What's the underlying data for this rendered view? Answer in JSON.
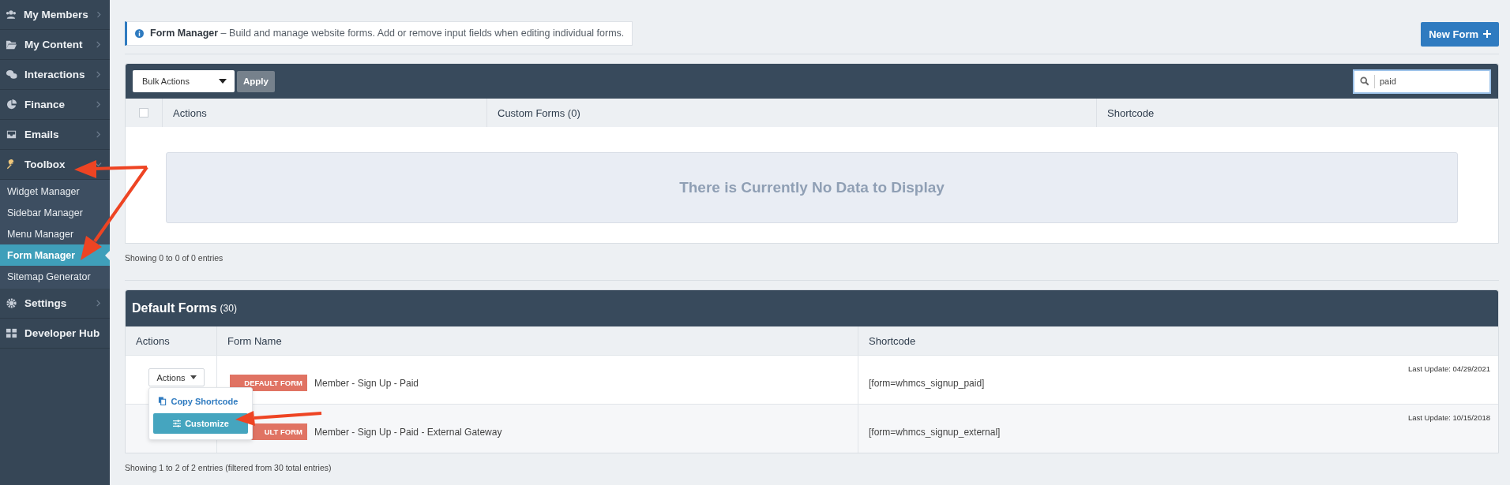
{
  "sidebar": {
    "items": [
      {
        "label": "My Members",
        "kind": "menu",
        "expanded": false
      },
      {
        "label": "My Content",
        "kind": "menu",
        "expanded": false
      },
      {
        "label": "Interactions",
        "kind": "menu",
        "expanded": false
      },
      {
        "label": "Finance",
        "kind": "menu",
        "expanded": false
      },
      {
        "label": "Emails",
        "kind": "menu",
        "expanded": false
      },
      {
        "label": "Toolbox",
        "kind": "menu",
        "expanded": true,
        "children": [
          {
            "label": "Widget Manager",
            "selected": false
          },
          {
            "label": "Sidebar Manager",
            "selected": false
          },
          {
            "label": "Menu Manager",
            "selected": false
          },
          {
            "label": "Form Manager",
            "selected": true
          },
          {
            "label": "Sitemap Generator",
            "selected": false
          }
        ]
      },
      {
        "label": "Settings",
        "kind": "menu",
        "expanded": false
      },
      {
        "label": "Developer Hub",
        "kind": "link",
        "expanded": false
      }
    ]
  },
  "notice": {
    "text": "**Form Manager** – Build and manage website forms. Add or remove input fields when editing individual forms."
  },
  "new_form_button": {
    "label": "New Form"
  },
  "custom_forms": {
    "bulk_actions": {
      "value": "Bulk Actions"
    },
    "apply_button": "Apply",
    "search": {
      "value": "paid"
    },
    "select_all": {
      "checked": false
    },
    "columns": [
      "Actions",
      "Custom Forms (0)",
      "Shortcode"
    ],
    "empty_message": "There is Currently No Data to Display",
    "footer": "Showing 0 to 0 of 0 entries"
  },
  "default_forms": {
    "title": "Default Forms",
    "count": "(30)",
    "columns": [
      "Actions",
      "Form Name",
      "Shortcode"
    ],
    "rows": [
      {
        "badge": "DEFAULT FORM",
        "name": "Member - Sign Up - Paid",
        "shortcode": "[form=whmcs_signup_paid]",
        "last_update": "Last Update: 04/29/2021"
      },
      {
        "badge": "ULT FORM",
        "name": "Member - Sign Up - Paid - External Gateway",
        "shortcode": "[form=whmcs_signup_external]",
        "last_update": "Last Update: 10/15/2018"
      }
    ],
    "actions_menu": {
      "button": "Actions",
      "items": [
        {
          "label": "Copy Shortcode",
          "selected": false
        },
        {
          "label": "Customize",
          "selected": true
        }
      ]
    },
    "footer": "Showing 1 to 2 of 2 entries (filtered from 30 total entries)"
  }
}
